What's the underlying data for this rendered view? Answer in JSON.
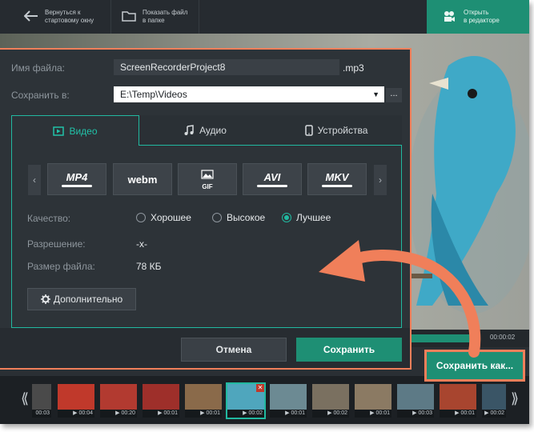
{
  "topbar": {
    "back_label": "Вернуться к стартовому окну",
    "back_line1": "Вернуться к",
    "back_line2": "стартовому окну",
    "folder_line1": "Показать файл",
    "folder_line2": "в папке",
    "editor_line1": "Открыть",
    "editor_line2": "в редакторе"
  },
  "dialog": {
    "filename_label": "Имя файла:",
    "filename_value": "ScreenRecorderProject8",
    "extension": ".mp3",
    "save_to_label": "Сохранить в:",
    "save_to_value": "E:\\Temp\\Videos",
    "browse_label": "...",
    "tabs": [
      "Видео",
      "Аудио",
      "Устройства"
    ],
    "formats": [
      "MP4",
      "webm",
      "GIF",
      "AVI",
      "MKV"
    ],
    "quality_label": "Качество:",
    "quality_options": [
      "Хорошее",
      "Высокое",
      "Лучшее"
    ],
    "quality_selected": "Лучшее",
    "resolution_label": "Разрешение:",
    "resolution_value": "-x-",
    "filesize_label": "Размер файла:",
    "filesize_value": "78 КБ",
    "advanced_label": "Дополнительно",
    "cancel_label": "Отмена",
    "save_label": "Сохранить"
  },
  "save_as_label": "Сохранить как...",
  "timeline": {
    "time": "00:00:02"
  },
  "thumbnails": [
    "00:03",
    "00:04",
    "00:20",
    "00:01",
    "00:01",
    "00:02",
    "00:01",
    "00:02",
    "00:01",
    "00:03",
    "00:01",
    "00:02"
  ],
  "colors": {
    "accent": "#1e8f74",
    "highlight": "#f07f5a",
    "tab_border": "#21b9a0"
  }
}
